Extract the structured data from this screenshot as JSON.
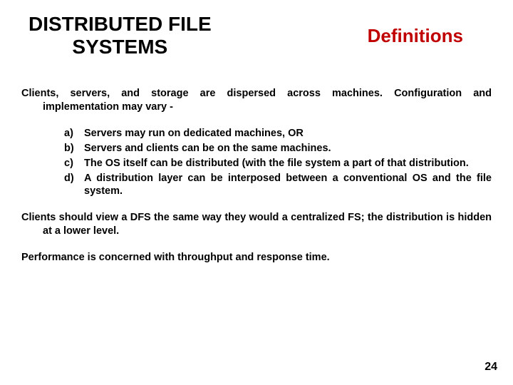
{
  "header": {
    "title_left_line1": "DISTRIBUTED FILE",
    "title_left_line2": "SYSTEMS",
    "title_right": "Definitions"
  },
  "body": {
    "intro": "Clients, servers, and storage are dispersed across machines. Configuration and implementation may vary -",
    "items": [
      {
        "marker": "a)",
        "text": "Servers may run on dedicated machines, OR"
      },
      {
        "marker": "b)",
        "text": "Servers and clients can be on the same machines."
      },
      {
        "marker": "c)",
        "text": "The OS itself can be distributed (with the file system a part of that distribution."
      },
      {
        "marker": "d)",
        "text": "A distribution layer can be interposed between a conventional OS and the file system."
      }
    ],
    "para2": "Clients should view a DFS the same way they would a centralized FS; the distribution is hidden at a lower level.",
    "para3": "Performance is concerned with throughput and response time."
  },
  "page_number": "24"
}
